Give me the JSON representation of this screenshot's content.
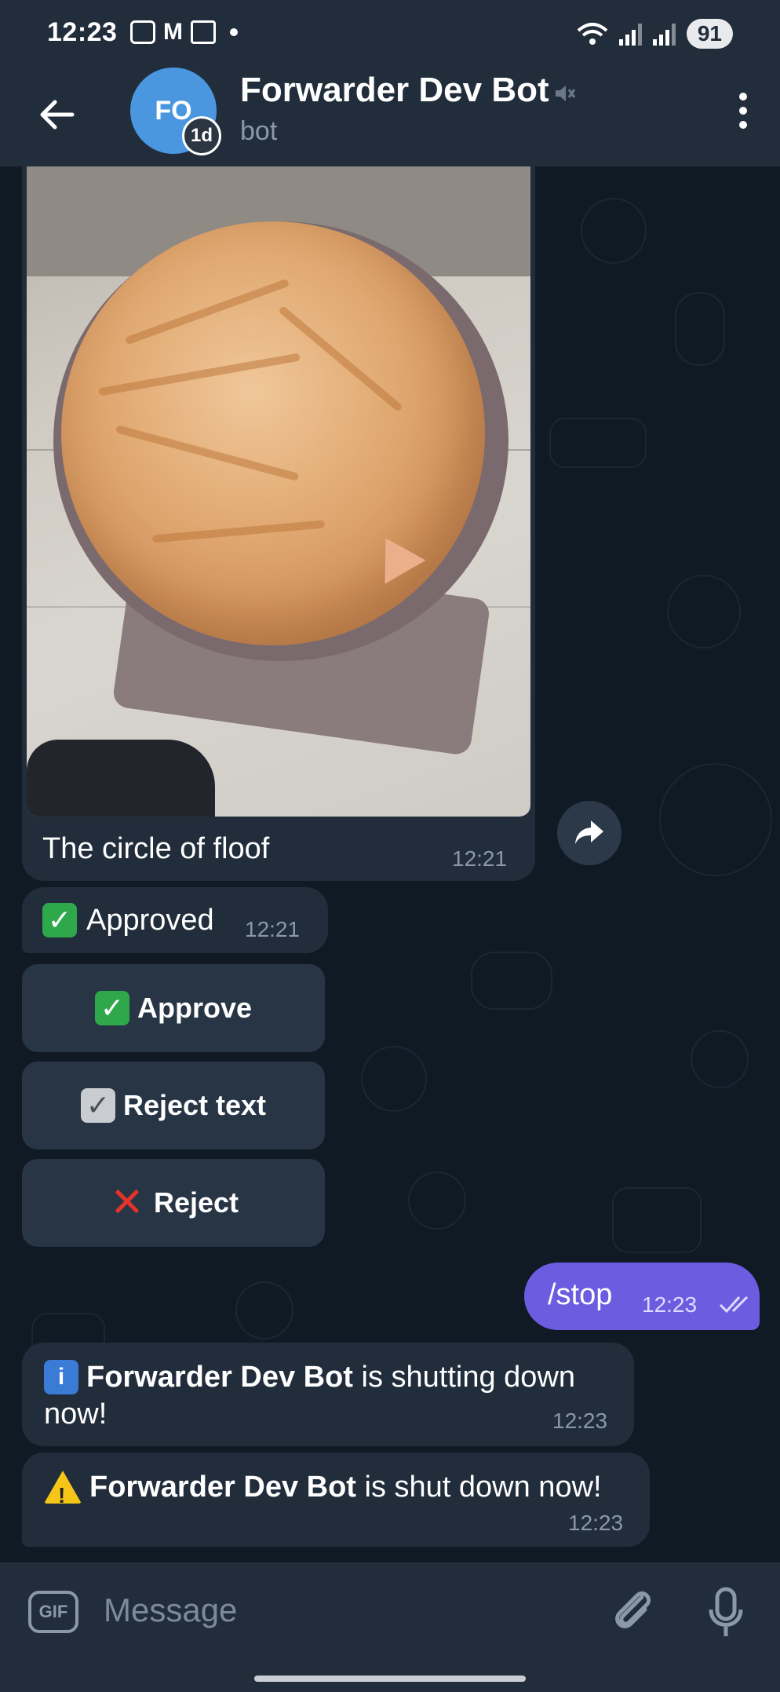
{
  "status_bar": {
    "time": "12:23",
    "battery": "91",
    "notification_icons": [
      "screenshot-icon",
      "gmail-icon",
      "phone-icon"
    ]
  },
  "header": {
    "avatar_initials": "FO",
    "avatar_badge": "1d",
    "title": "Forwarder Dev Bot",
    "subtitle": "bot"
  },
  "messages": {
    "photo": {
      "caption": "The circle of floof",
      "time": "12:21"
    },
    "approved": {
      "text": "Approved",
      "time": "12:21"
    },
    "buttons": {
      "approve": "Approve",
      "reject_text": "Reject text",
      "reject": "Reject"
    },
    "outgoing": {
      "text": "/stop",
      "time": "12:23"
    },
    "info": {
      "bold": "Forwarder Dev Bot",
      "rest": " is shutting down",
      "line2": "now!",
      "time": "12:23"
    },
    "warning": {
      "bold": "Forwarder Dev Bot",
      "rest": " is shut down now!",
      "time": "12:23"
    }
  },
  "input": {
    "gif_label": "GIF",
    "placeholder": "Message"
  },
  "colors": {
    "header_bg": "#212d3b",
    "chat_bg": "#101a25",
    "incoming_bubble": "#212d3b",
    "outgoing_bubble": "#6c5ce0",
    "muted_text": "#8a99a8"
  }
}
